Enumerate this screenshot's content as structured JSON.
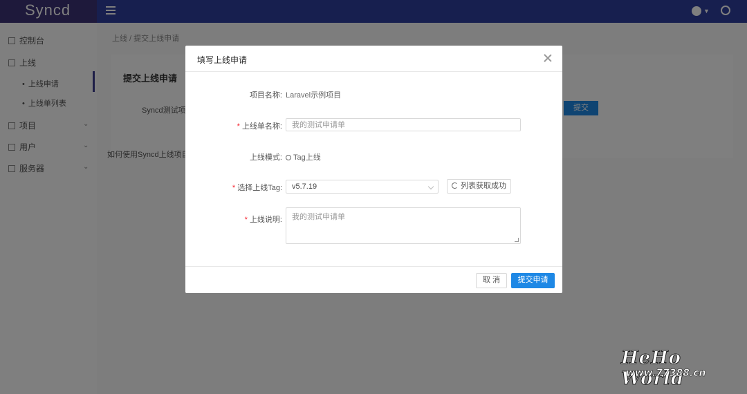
{
  "app": {
    "logo": "Syncd"
  },
  "sidebar": {
    "items": [
      {
        "label": "控制台"
      },
      {
        "label": "上线"
      },
      {
        "label": "上线申请"
      },
      {
        "label": "上线单列表"
      },
      {
        "label": "项目"
      },
      {
        "label": "用户"
      },
      {
        "label": "服务器"
      }
    ]
  },
  "background": {
    "breadcrumb": "上线 / 提交上线申请",
    "panel_title": "提交上线申请",
    "panel_label": "Syncd测试项目",
    "panel_button": "提交",
    "panel_note": "如何使用Syncd上线项目"
  },
  "modal": {
    "title": "填写上线申请",
    "fields": {
      "project_name": {
        "label": "项目名称:",
        "value": "Laravel示例项目"
      },
      "order_name": {
        "label": "上线单名称:",
        "value": "",
        "placeholder": "我的测试申请单"
      },
      "deploy_mode": {
        "label": "上线模式:",
        "value": "Tag上线"
      },
      "tag": {
        "label": "选择上线Tag:",
        "value": "v5.7.19",
        "refresh_label": "列表获取成功"
      },
      "description": {
        "label": "上线说明:",
        "value": "",
        "placeholder": "我的测试申请单"
      }
    },
    "footer": {
      "cancel_label": "取 消",
      "submit_label": "提交申请"
    }
  },
  "watermark": {
    "title": "HeHo World",
    "url": "www.77388.cn"
  },
  "colors": {
    "header": "#2f3f9e",
    "logo_bg": "#3c3277",
    "primary": "#1e88e5",
    "required": "#f5222d"
  }
}
